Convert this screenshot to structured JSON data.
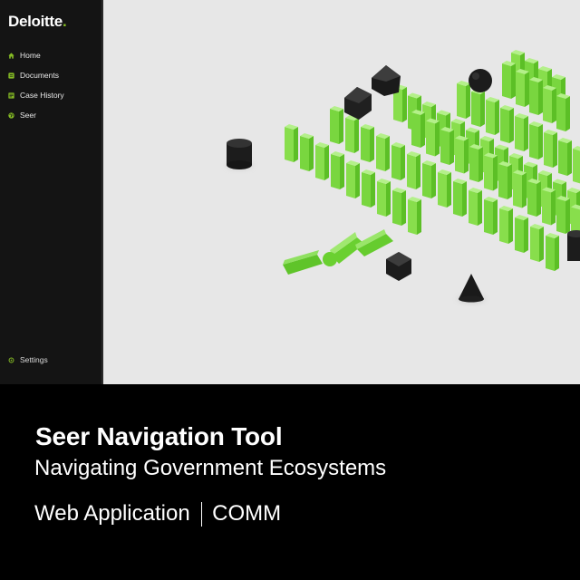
{
  "app": {
    "logo_text": "Deloitte",
    "logo_dot": ".",
    "brand_color": "#86bc25"
  },
  "sidebar": {
    "items": [
      {
        "label": "Home",
        "icon": "home-icon"
      },
      {
        "label": "Documents",
        "icon": "documents-icon"
      },
      {
        "label": "Case History",
        "icon": "case-history-icon"
      },
      {
        "label": "Seer",
        "icon": "globe-icon"
      }
    ],
    "settings_label": "Settings",
    "settings_icon": "gear-icon"
  },
  "caption": {
    "title": "Seer Navigation Tool",
    "subtitle": "Navigating Government Ecosystems",
    "type": "Web Application",
    "category": "COMM"
  }
}
